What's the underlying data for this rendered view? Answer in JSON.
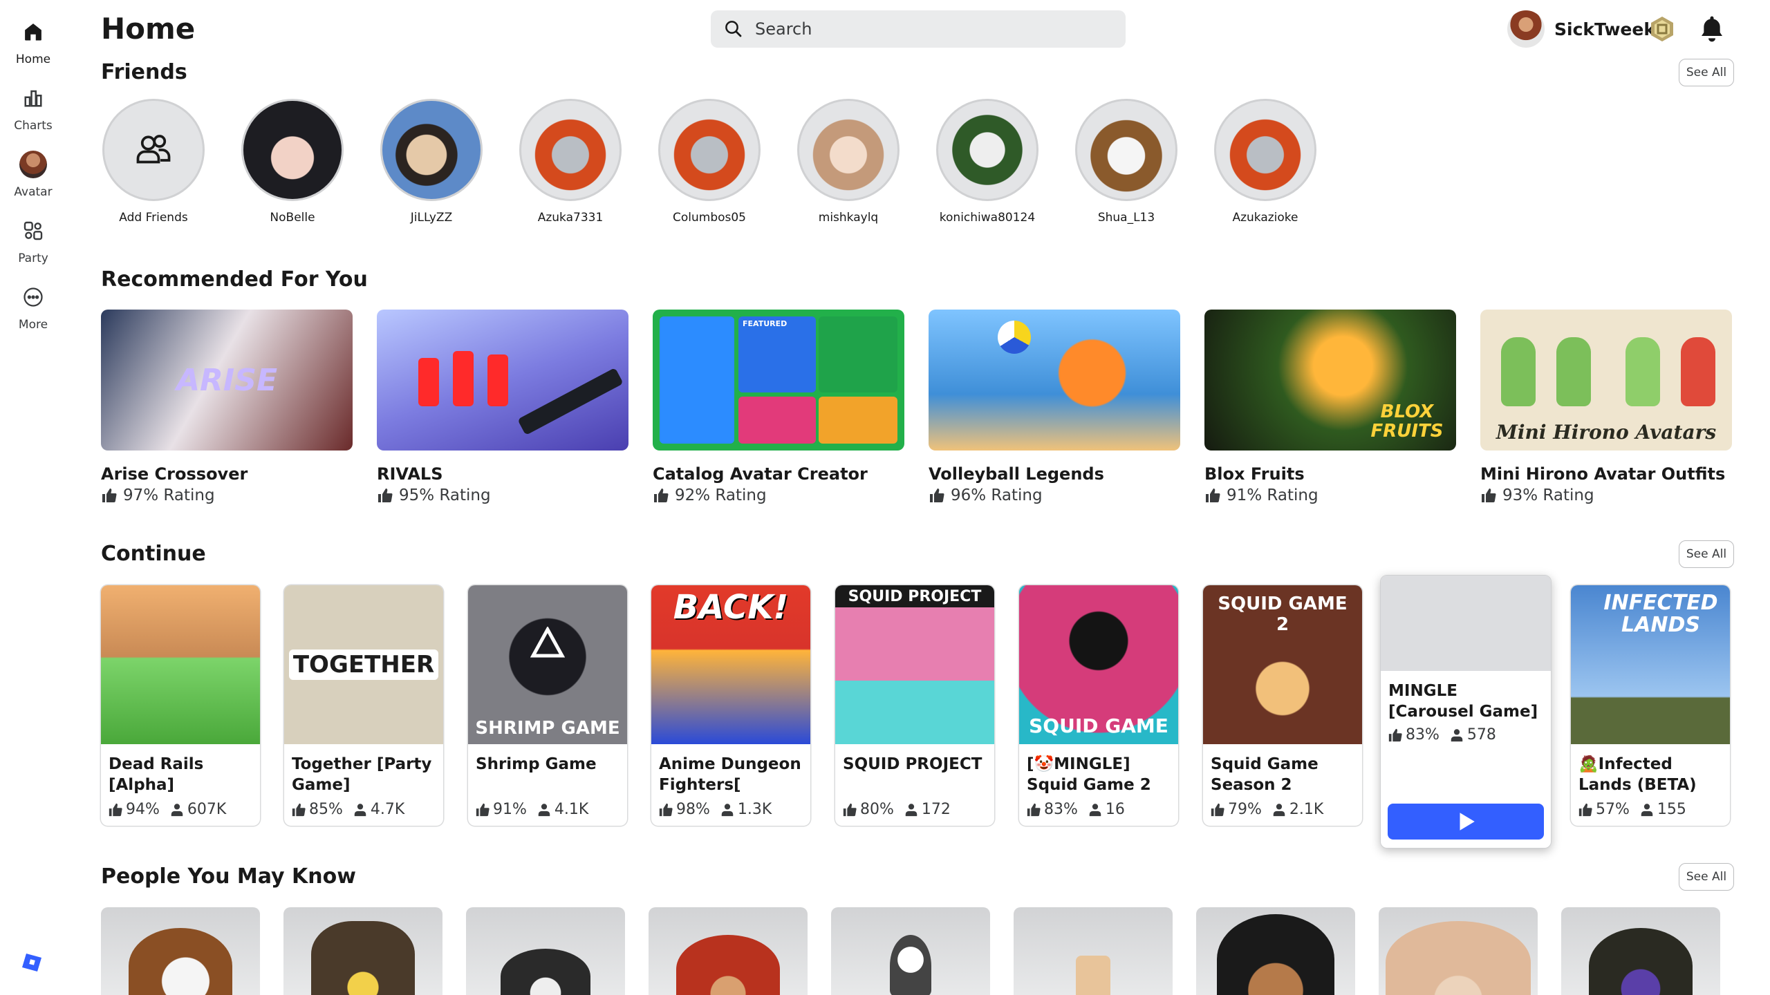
{
  "nav": {
    "items": [
      {
        "label": "Home"
      },
      {
        "label": "Charts"
      },
      {
        "label": "Avatar"
      },
      {
        "label": "Party"
      },
      {
        "label": "More"
      }
    ]
  },
  "header": {
    "title": "Home",
    "search_placeholder": "Search",
    "username": "SickTweek"
  },
  "friends": {
    "title": "Friends",
    "see_all": "See All",
    "items": [
      {
        "name": "Add Friends"
      },
      {
        "name": "NoBelle"
      },
      {
        "name": "JiLLyZZ"
      },
      {
        "name": "Azuka7331"
      },
      {
        "name": "Columbos05"
      },
      {
        "name": "mishkaylq"
      },
      {
        "name": "konichiwa80124"
      },
      {
        "name": "Shua_L13"
      },
      {
        "name": "Azukazioke"
      }
    ]
  },
  "recommended": {
    "title": "Recommended For You",
    "items": [
      {
        "title": "Arise Crossover",
        "rating": "97% Rating",
        "color": "#6e4f52",
        "thumb_text": "ARISE"
      },
      {
        "title": "RIVALS",
        "rating": "95% Rating",
        "color": "#7c7ce0",
        "thumb_text": ""
      },
      {
        "title": "Catalog Avatar Creator",
        "rating": "92% Rating",
        "color": "#22b04a",
        "thumb_text": "FEATURED"
      },
      {
        "title": "Volleyball Legends",
        "rating": "96% Rating",
        "color": "#3f8fd8",
        "thumb_text": ""
      },
      {
        "title": "Blox Fruits",
        "rating": "91% Rating",
        "color": "#3d4a2a",
        "thumb_text": "BLOX FRUITS"
      },
      {
        "title": "Mini Hirono Avatar Outfits [N...",
        "rating": "93% Rating",
        "color": "#e9dcc0",
        "thumb_text": "Mini Hirono Avatars"
      }
    ]
  },
  "continue": {
    "title": "Continue",
    "see_all": "See All",
    "items": [
      {
        "title": "Dead Rails [Alpha]",
        "rating": "94%",
        "players": "607K",
        "color": "#c98a55",
        "thumb_text": ""
      },
      {
        "title": "Together [Party Game]",
        "rating": "85%",
        "players": "4.7K",
        "color": "#d8d0bd",
        "thumb_text": "TOGETHER"
      },
      {
        "title": "Shrimp Game",
        "rating": "91%",
        "players": "4.1K",
        "color": "#7e7e84",
        "thumb_text": "SHRIMP GAME"
      },
      {
        "title": "Anime Dungeon Fighters[ Easter...",
        "rating": "98%",
        "players": "1.3K",
        "color": "#d8342b",
        "thumb_text": "BACK!"
      },
      {
        "title": "SQUID PROJECT",
        "rating": "80%",
        "players": "172",
        "color": "#e77fb0",
        "thumb_text": "SQUID PROJECT"
      },
      {
        "title": "[🤡MINGLE] Squid Game 2",
        "rating": "83%",
        "players": "16",
        "color": "#d53c7a",
        "thumb_text": "SQUID GAME"
      },
      {
        "title": "Squid Game Season 2",
        "rating": "79%",
        "players": "2.1K",
        "color": "#6b3424",
        "thumb_text": "SQUID GAME 2"
      },
      {
        "title": "MINGLE [Carousel Game]",
        "rating": "83%",
        "players": "578",
        "color": "#dcdde0",
        "thumb_text": ""
      },
      {
        "title": "🧟Infected Lands (BETA)",
        "rating": "57%",
        "players": "155",
        "color": "#4a86d0",
        "thumb_text": "INFECTED LANDS"
      }
    ]
  },
  "people": {
    "title": "People You May Know",
    "see_all": "See All"
  }
}
